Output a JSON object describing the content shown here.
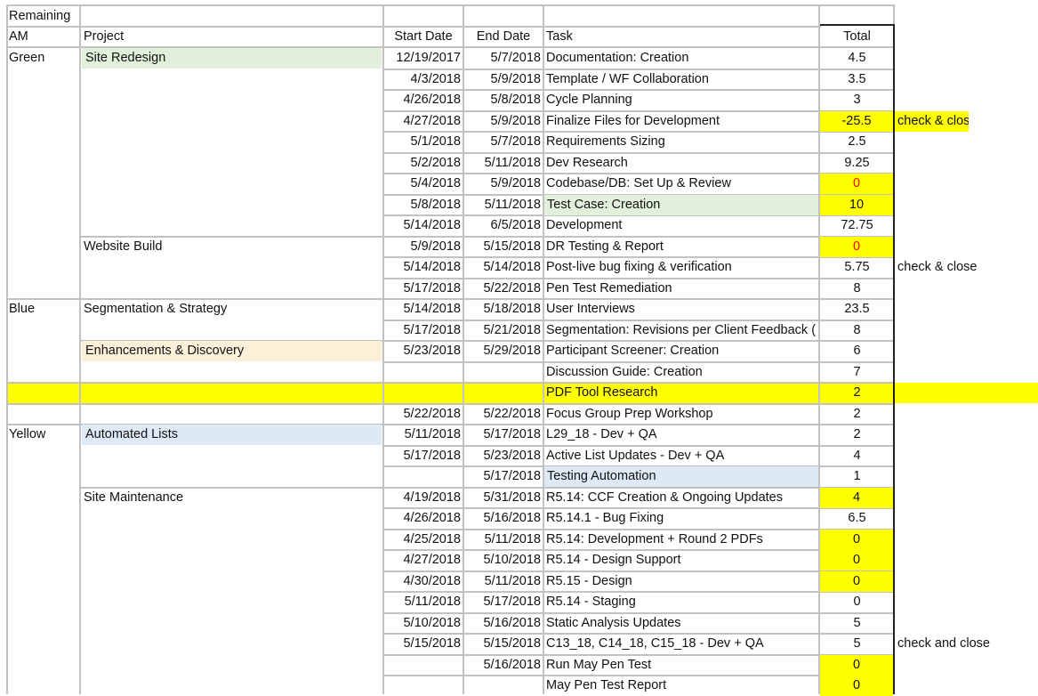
{
  "title": "Remaining",
  "headers": {
    "am": "AM",
    "project": "Project",
    "start": "Start Date",
    "end": "End Date",
    "task": "Task",
    "total": "Total"
  },
  "colors": {
    "yellow": "#ffff00",
    "green": "#e2efda",
    "orange": "#fdf0d8",
    "blue": "#dde9f5",
    "grid": "#c2c2c2",
    "red": "#ff0000"
  },
  "rows": [
    {
      "am": "Green",
      "project": "Site Redesign",
      "start": "12/19/2017",
      "end": "5/7/2018",
      "task": "Documentation: Creation",
      "total": "4.5",
      "note": ""
    },
    {
      "am": "",
      "project": "",
      "start": "4/3/2018",
      "end": "5/9/2018",
      "task": "Template / WF Collaboration",
      "total": "3.5",
      "note": ""
    },
    {
      "am": "",
      "project": "",
      "start": "4/26/2018",
      "end": "5/8/2018",
      "task": "Cycle Planning",
      "total": "3",
      "note": ""
    },
    {
      "am": "",
      "project": "",
      "start": "4/27/2018",
      "end": "5/9/2018",
      "task": "Finalize Files for Development",
      "total": "-25.5",
      "note": "check & close"
    },
    {
      "am": "",
      "project": "",
      "start": "5/1/2018",
      "end": "5/7/2018",
      "task": "Requirements Sizing",
      "total": "2.5",
      "note": ""
    },
    {
      "am": "",
      "project": "",
      "start": "5/2/2018",
      "end": "5/11/2018",
      "task": "Dev Research",
      "total": "9.25",
      "note": ""
    },
    {
      "am": "",
      "project": "",
      "start": "5/4/2018",
      "end": "5/9/2018",
      "task": "Codebase/DB: Set Up & Review",
      "total": "0",
      "note": ""
    },
    {
      "am": "",
      "project": "",
      "start": "5/8/2018",
      "end": "5/11/2018",
      "task": "Test Case: Creation",
      "total": "10",
      "note": ""
    },
    {
      "am": "",
      "project": "",
      "start": "5/14/2018",
      "end": "6/5/2018",
      "task": "Development",
      "total": "72.75",
      "note": ""
    },
    {
      "am": "",
      "project": "Website Build",
      "start": "5/9/2018",
      "end": "5/15/2018",
      "task": "DR Testing & Report",
      "total": "0",
      "note": ""
    },
    {
      "am": "",
      "project": "",
      "start": "5/14/2018",
      "end": "5/14/2018",
      "task": "Post-live bug fixing & verification",
      "total": "5.75",
      "note": "check & close"
    },
    {
      "am": "",
      "project": "",
      "start": "5/17/2018",
      "end": "5/22/2018",
      "task": "Pen Test Remediation",
      "total": "8",
      "note": ""
    },
    {
      "am": "Blue",
      "project": "Segmentation & Strategy",
      "start": "5/14/2018",
      "end": "5/18/2018",
      "task": "User Interviews",
      "total": "23.5",
      "note": ""
    },
    {
      "am": "",
      "project": "",
      "start": "5/17/2018",
      "end": "5/21/2018",
      "task": "Segmentation: Revisions per Client Feedback (",
      "total": "8",
      "note": ""
    },
    {
      "am": "",
      "project": "Enhancements & Discovery",
      "start": "5/23/2018",
      "end": "5/29/2018",
      "task": "Participant Screener: Creation",
      "total": "6",
      "note": ""
    },
    {
      "am": "",
      "project": "",
      "start": "",
      "end": "",
      "task": "Discussion Guide: Creation",
      "total": "7",
      "note": ""
    },
    {
      "am": "",
      "project": "",
      "start": "",
      "end": "",
      "task": "PDF Tool Research",
      "total": "2",
      "note": ""
    },
    {
      "am": "",
      "project": "",
      "start": "5/22/2018",
      "end": "5/22/2018",
      "task": "Focus Group Prep Workshop",
      "total": "2",
      "note": ""
    },
    {
      "am": "Yellow",
      "project": "Automated Lists",
      "start": "5/11/2018",
      "end": "5/17/2018",
      "task": "L29_18 - Dev + QA",
      "total": "2",
      "note": ""
    },
    {
      "am": "",
      "project": "",
      "start": "5/17/2018",
      "end": "5/23/2018",
      "task": "Active List Updates - Dev + QA",
      "total": "4",
      "note": ""
    },
    {
      "am": "",
      "project": "",
      "start": "",
      "end": "5/17/2018",
      "task": "Testing Automation",
      "total": "1",
      "note": ""
    },
    {
      "am": "",
      "project": "Site Maintenance",
      "start": "4/19/2018",
      "end": "5/31/2018",
      "task": "R5.14: CCF Creation & Ongoing Updates",
      "total": "4",
      "note": ""
    },
    {
      "am": "",
      "project": "",
      "start": "4/26/2018",
      "end": "5/16/2018",
      "task": "R5.14.1 - Bug Fixing",
      "total": "6.5",
      "note": ""
    },
    {
      "am": "",
      "project": "",
      "start": "4/25/2018",
      "end": "5/11/2018",
      "task": "R5.14: Development + Round 2 PDFs",
      "total": "0",
      "note": ""
    },
    {
      "am": "",
      "project": "",
      "start": "4/27/2018",
      "end": "5/10/2018",
      "task": "R5.14 - Design Support",
      "total": "0",
      "note": ""
    },
    {
      "am": "",
      "project": "",
      "start": "4/30/2018",
      "end": "5/11/2018",
      "task": "R5.15 - Design",
      "total": "0",
      "note": ""
    },
    {
      "am": "",
      "project": "",
      "start": "5/11/2018",
      "end": "5/17/2018",
      "task": "R5.14 - Staging",
      "total": "0",
      "note": ""
    },
    {
      "am": "",
      "project": "",
      "start": "5/10/2018",
      "end": "5/16/2018",
      "task": "Static Analysis Updates",
      "total": "5",
      "note": ""
    },
    {
      "am": "",
      "project": "",
      "start": "5/15/2018",
      "end": "5/15/2018",
      "task": "C13_18, C14_18, C15_18 - Dev + QA",
      "total": "5",
      "note": "check and close"
    },
    {
      "am": "",
      "project": "",
      "start": "",
      "end": "5/16/2018",
      "task": "Run May Pen Test",
      "total": "0",
      "note": ""
    },
    {
      "am": "",
      "project": "",
      "start": "",
      "end": "",
      "task": "May Pen Test Report",
      "total": "0",
      "note": ""
    }
  ]
}
